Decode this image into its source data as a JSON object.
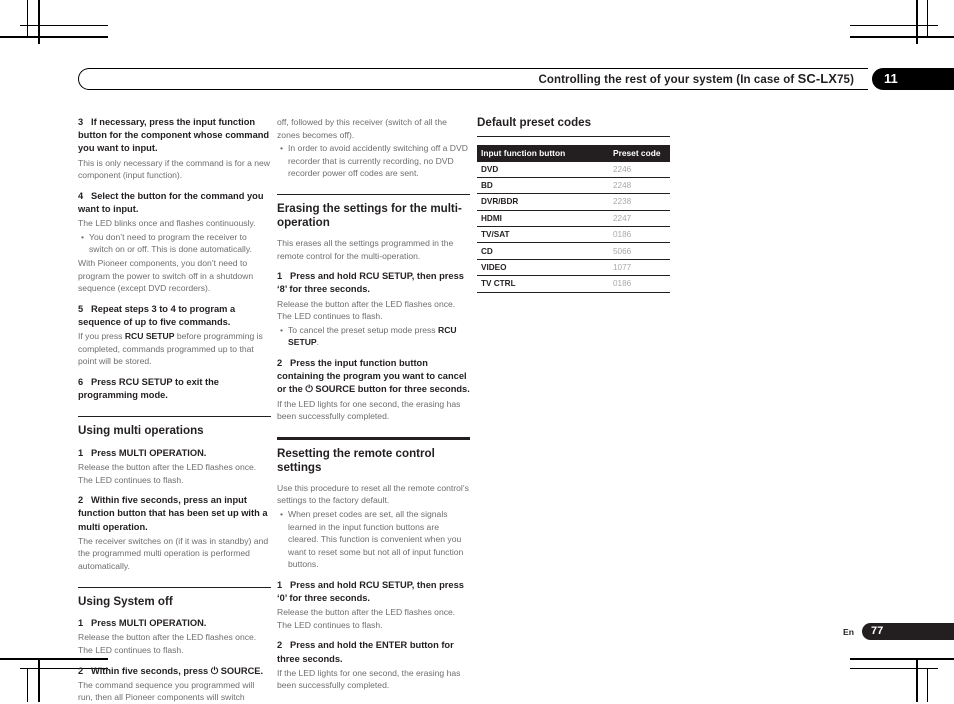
{
  "header": {
    "title_prefix": "Controlling the rest of your system (In case of ",
    "model_bold": "SC-LX",
    "model_rest": "75",
    "title_suffix": ")",
    "full_title": "Controlling the rest of your system (In case of SC-LX75)",
    "chapter_number": "11"
  },
  "footer": {
    "language": "En",
    "page_number": "77"
  },
  "column_1": {
    "step3": {
      "num": "3",
      "title": "If necessary, press the input function button for the component whose command you want to input.",
      "body": "This is only necessary if the command is for a new component (input function)."
    },
    "step4": {
      "num": "4",
      "title": "Select the button for the command you want to input.",
      "body": "The LED blinks once and flashes continuously.",
      "bullet": "You don’t need to program the receiver to switch on or off. This is done automatically.",
      "body2": "With Pioneer components, you don’t need to program the power to switch off in a shutdown sequence (except DVD recorders)."
    },
    "step5": {
      "num": "5",
      "title": "Repeat steps 3 to 4 to program a sequence of up to five commands.",
      "body_pre": "If you press ",
      "body_bold": "RCU SETUP",
      "body_post": " before programming is completed, commands programmed up to that point will be stored."
    },
    "step6": {
      "num": "6",
      "title": "Press RCU SETUP to exit the programming mode."
    },
    "section_multi": {
      "heading": "Using multi operations",
      "step1": {
        "num": "1",
        "title": "Press MULTI OPERATION.",
        "body": "Release the button after the LED flashes once. The LED continues to flash."
      },
      "step2": {
        "num": "2",
        "title": "Within five seconds, press an input function button that has been set up with a multi operation.",
        "body": "The receiver switches on (if it was in standby) and the programmed multi operation is performed automatically."
      }
    },
    "section_systemoff": {
      "heading": "Using System off",
      "step1": {
        "num": "1",
        "title": "Press MULTI OPERATION.",
        "body": "Release the button after the LED flashes once. The LED continues to flash."
      },
      "step2": {
        "num": "2",
        "title_pre": "Within five seconds, press ",
        "title_glyph": "⏻",
        "title_post": " SOURCE.",
        "body": "The command sequence you programmed will run, then all Pioneer components will switch"
      }
    }
  },
  "column_2": {
    "continued_text": "off, followed by this receiver (switch of all the zones becomes off).",
    "continued_bullet": "In order to avoid accidently switching off a DVD recorder that is currently recording, no DVD recorder power off codes are sent.",
    "section_erasing": {
      "heading": "Erasing the settings for the multi-operation",
      "intro": "This erases all the settings programmed in the remote control for the multi-operation.",
      "step1": {
        "num": "1",
        "title": "Press and hold RCU SETUP, then press ‘8’ for three seconds.",
        "body": "Release the button after the LED flashes once. The LED continues to flash.",
        "bullet_pre": "To cancel the preset setup mode press ",
        "bullet_bold": "RCU SETUP",
        "bullet_post": "."
      },
      "step2": {
        "num": "2",
        "title_pre": "Press the input function button containing the program you want to cancel or the ",
        "title_glyph": "⏻",
        "title_post": " SOURCE button for three seconds.",
        "body": "If the LED lights for one second, the erasing has been successfully completed."
      }
    },
    "section_resetting": {
      "heading": "Resetting the remote control settings",
      "intro": "Use this procedure to reset all the remote control’s settings to the factory default.",
      "bullet": "When preset codes are set, all the signals learned in the input function buttons are cleared. This function is convenient when you want to reset some but not all of input function buttons.",
      "step1": {
        "num": "1",
        "title": "Press and hold RCU SETUP, then press ‘0’ for three seconds.",
        "body": "Release the button after the LED flashes once. The LED continues to flash."
      },
      "step2": {
        "num": "2",
        "title": "Press and hold the ENTER button for three seconds.",
        "body": "If the LED lights for one second, the erasing has been successfully completed."
      }
    }
  },
  "column_3": {
    "heading": "Default preset codes",
    "table": {
      "headers": [
        "Input function button",
        "Preset code"
      ],
      "rows": [
        [
          "DVD",
          "2246"
        ],
        [
          "BD",
          "2248"
        ],
        [
          "DVR/BDR",
          "2238"
        ],
        [
          "HDMI",
          "2247"
        ],
        [
          "TV/SAT",
          "0186"
        ],
        [
          "CD",
          "5066"
        ],
        [
          "VIDEO",
          "1077"
        ],
        [
          "TV CTRL",
          "0186"
        ]
      ]
    }
  }
}
